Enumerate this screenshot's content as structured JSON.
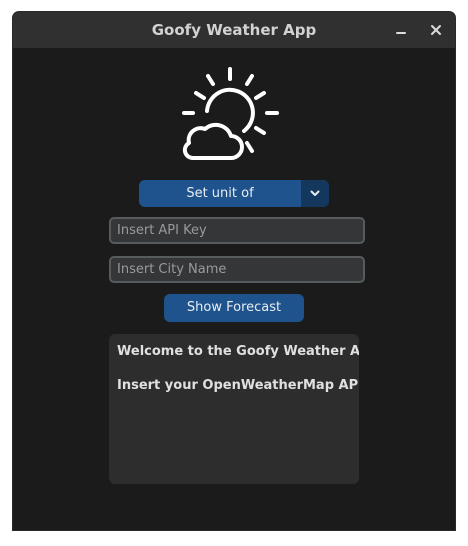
{
  "window": {
    "title": "Goofy Weather App",
    "controls": [
      "minimize-icon",
      "close-icon"
    ]
  },
  "logo": {
    "icon": "sun-behind-cloud-icon"
  },
  "unit_select": {
    "label": "Set unit of measurement",
    "icon": "chevron-down-icon"
  },
  "inputs": {
    "api_key": {
      "placeholder": "Insert API Key",
      "value": ""
    },
    "city": {
      "placeholder": "Insert City Name",
      "value": ""
    }
  },
  "forecast_button": {
    "label": "Show Forecast"
  },
  "output": {
    "line1": "Welcome to the Goofy Weather App!",
    "line2": "Insert your OpenWeatherMap API Key"
  },
  "colors": {
    "window_bg": "#1b1b1b",
    "titlebar_bg": "#303030",
    "accent": "#1f538d",
    "accent_dark": "#14375e",
    "entry_bg": "#343638",
    "entry_border": "#565b5e",
    "textbox_bg": "#2d2d2d"
  }
}
